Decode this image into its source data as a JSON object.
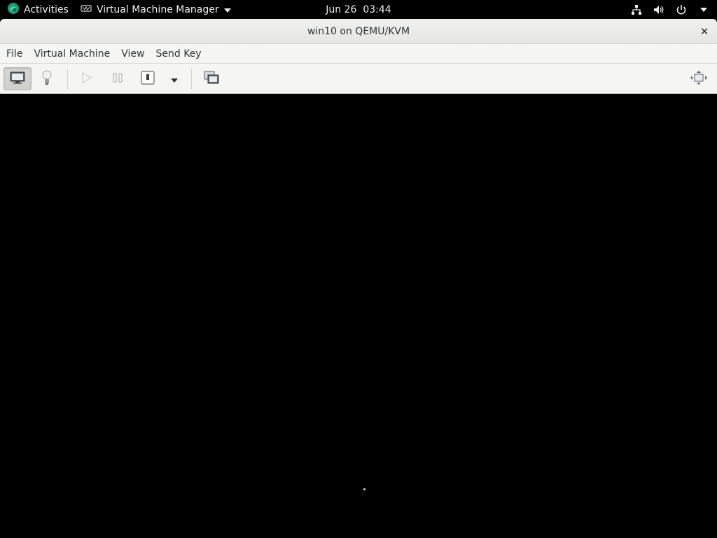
{
  "topbar": {
    "activities_label": "Activities",
    "app_name": "Virtual Machine Manager",
    "clock": "Jun 26  03:44"
  },
  "window": {
    "title": "win10 on QEMU/KVM",
    "close_glyph": "✕"
  },
  "menubar": {
    "items": [
      {
        "label": "File"
      },
      {
        "label": "Virtual Machine"
      },
      {
        "label": "View"
      },
      {
        "label": "Send Key"
      }
    ]
  },
  "toolbar": {
    "buttons": [
      {
        "icon": "monitor-console-icon",
        "active": true
      },
      {
        "icon": "lightbulb-details-icon",
        "active": false
      },
      {
        "icon": "play-run-icon",
        "enabled": false
      },
      {
        "icon": "pause-icon",
        "enabled": false
      },
      {
        "icon": "shutdown-icon",
        "enabled": true
      },
      {
        "icon": "chevron-down-icon",
        "enabled": true
      },
      {
        "icon": "snapshots-icon",
        "enabled": true
      },
      {
        "icon": "fullscreen-icon",
        "enabled": true
      }
    ]
  },
  "colors": {
    "topbar_bg": "#000000",
    "window_chrome": "#f5f5f4",
    "console_bg": "#000000"
  }
}
